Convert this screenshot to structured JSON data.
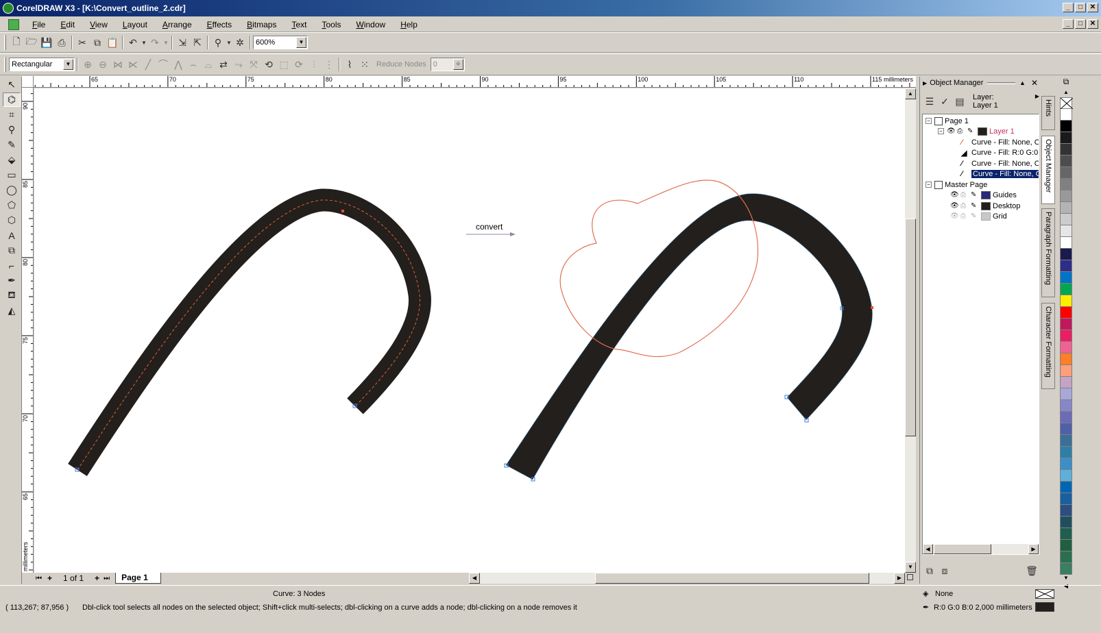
{
  "window": {
    "title": "CorelDRAW X3 - [K:\\Convert_outline_2.cdr]",
    "min": "_",
    "max": "□",
    "close": "✕"
  },
  "menu": [
    "File",
    "Edit",
    "View",
    "Layout",
    "Arrange",
    "Effects",
    "Bitmaps",
    "Text",
    "Tools",
    "Window",
    "Help"
  ],
  "toolbar": {
    "zoom": "600%"
  },
  "propertybar": {
    "selection_mode": "Rectangular",
    "reduce_nodes_label": "Reduce Nodes",
    "reduce_nodes_value": "0"
  },
  "ruler": {
    "unit": "millimeters",
    "h_ticks": [
      "65",
      "70",
      "75",
      "80",
      "85",
      "90",
      "95",
      "100",
      "105",
      "110",
      "115"
    ],
    "v_ticks": [
      "90",
      "85",
      "80",
      "75",
      "70",
      "65"
    ]
  },
  "canvas": {
    "annotation": "convert"
  },
  "pages": {
    "counter": "1 of 1",
    "tab": "Page 1"
  },
  "docker": {
    "title": "Object Manager",
    "layer_label": "Layer:",
    "layer_name": "Layer 1",
    "tree": {
      "page1": "Page 1",
      "layer1": "Layer 1",
      "items": [
        "Curve - Fill: None, O",
        "Curve - Fill: R:0 G:0",
        "Curve - Fill: None, O",
        "Curve - Fill: None, O"
      ],
      "master": "Master Page",
      "guides": "Guides",
      "desktop": "Desktop",
      "grid": "Grid"
    }
  },
  "sidetabs": [
    "Hints",
    "Object Manager",
    "Paragraph Formatting",
    "Character Formatting"
  ],
  "palette": [
    "#ffffff",
    "#000000",
    "#1a1a1a",
    "#333333",
    "#4d4d4d",
    "#666666",
    "#808080",
    "#999999",
    "#b3b3b3",
    "#cccccc",
    "#e6e6e6",
    "#ffffff",
    "#1a1a4e",
    "#2d2d8a",
    "#0073c6",
    "#00a651",
    "#ffed00",
    "#ff0000",
    "#c2185b",
    "#e91e63",
    "#f06292",
    "#ff7f27",
    "#ff9e7a",
    "#c5a3c5",
    "#a8a8d8",
    "#8787c8",
    "#6b6bb8",
    "#4f5fa8",
    "#3a6f98",
    "#2e7fa8",
    "#3a8fc8",
    "#5fafd8",
    "#0066b3",
    "#1a5fa0",
    "#2a4f80",
    "#1f4f5f",
    "#1f5f4f",
    "#205f3f",
    "#2a6f4f",
    "#3a7f5f"
  ],
  "status": {
    "object_info": "Curve: 3 Nodes",
    "coords": "( 113,267; 87,956 )",
    "hint": "Dbl-click tool selects all nodes on the selected object; Shift+click multi-selects; dbl-clicking on a curve adds a node; dbl-clicking on a node removes it",
    "fill": "None",
    "outline": "R:0 G:0 B:0  2,000 millimeters"
  }
}
